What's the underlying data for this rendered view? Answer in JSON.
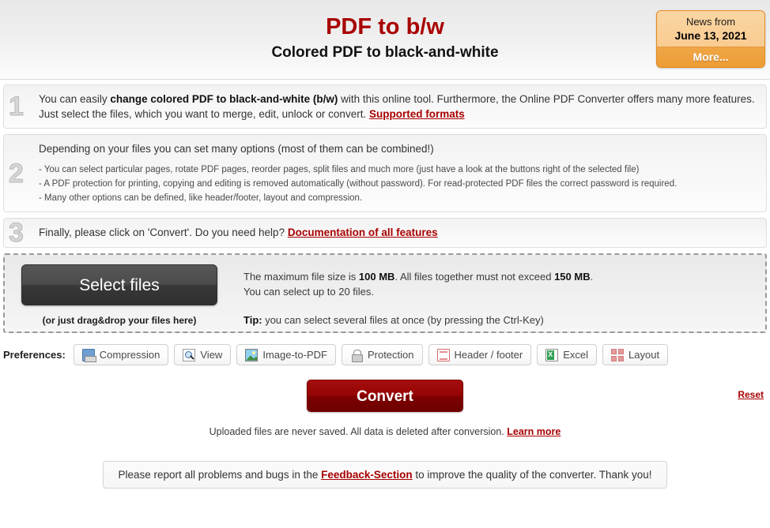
{
  "header": {
    "title": "PDF to b/w",
    "subtitle": "Colored PDF to black-and-white",
    "news": {
      "label": "News from",
      "date": "June 13, 2021",
      "more_label": "More...",
      "accent_color": "#ef9f3f",
      "panel_color": "#fad09a"
    }
  },
  "title_color": "#a80000",
  "steps": [
    {
      "number": "1",
      "text_parts": {
        "lead": "You can easily ",
        "bold": "change colored PDF to black-and-white (b/w)",
        "tail": " with this online tool. Furthermore, the Online PDF Converter offers many more features. Just select the files, which you want to merge, edit, unlock or convert. ",
        "link": "Supported formats"
      }
    },
    {
      "number": "2",
      "heading": "Depending on your files you can set many options (most of them can be combined!)",
      "bullets": [
        "- You can select particular pages, rotate PDF pages, reorder pages, split files and much more (just have a look at the buttons right of the selected file)",
        "- A PDF protection for printing, copying and editing is removed automatically (without password). For read-protected PDF files the correct password is required.",
        "- Many other options can be defined, like header/footer, layout and compression."
      ]
    },
    {
      "number": "3",
      "text_parts": {
        "lead": "Finally, please click on 'Convert'. Do you need help? ",
        "link": "Documentation of all features"
      }
    }
  ],
  "drop_area": {
    "select_files_label": "Select files",
    "drag_hint": "(or just drag&drop your files here)",
    "max_size_lead": "The maximum file size is ",
    "max_size_value": "100 MB",
    "max_size_mid": ". All files together must not exceed ",
    "total_size_value": "150 MB",
    "max_size_tail": ".",
    "file_count_line": "You can select up to 20 files.",
    "tip_label": "Tip:",
    "tip_text": " you can select several files at once (by pressing the Ctrl-Key)"
  },
  "preferences": {
    "label": "Preferences:",
    "buttons": [
      {
        "label": "Compression",
        "icon": "compression-icon"
      },
      {
        "label": "View",
        "icon": "magnifier-icon"
      },
      {
        "label": "Image-to-PDF",
        "icon": "image-icon"
      },
      {
        "label": "Protection",
        "icon": "lock-icon"
      },
      {
        "label": "Header / footer",
        "icon": "document-icon"
      },
      {
        "label": "Excel",
        "icon": "excel-icon"
      },
      {
        "label": "Layout",
        "icon": "layout-grid-icon"
      }
    ]
  },
  "actions": {
    "convert_label": "Convert",
    "convert_color": "#8e0202",
    "reset_label": "Reset"
  },
  "privacy": {
    "text": "Uploaded files are never saved. All data is deleted after conversion. ",
    "link": "Learn more"
  },
  "feedback": {
    "lead": "Please report all problems and bugs in the ",
    "link": "Feedback-Section",
    "tail": " to improve the quality of the converter. Thank you!"
  }
}
